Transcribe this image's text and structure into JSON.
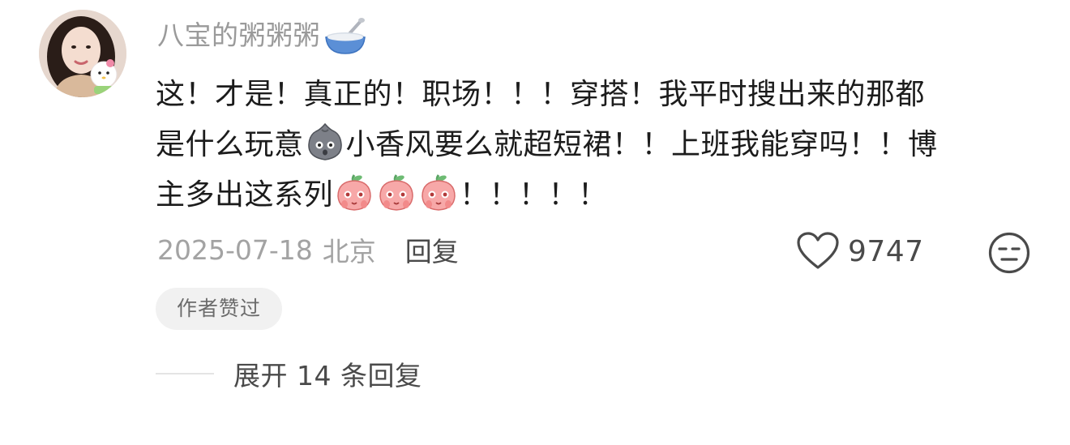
{
  "comment": {
    "avatar_icon": "user-avatar",
    "username": "八宝的粥粥粥",
    "username_emoji": "bowl-with-spoon-emoji",
    "text_lines": {
      "l1": "这！才是！真正的！职场！！！穿搭！我平时搜出来的那都",
      "l2a": "是什么玩意",
      "l2b": "小香风要么就超短裙！！上班我能穿吗！！博",
      "l3a": "主多出这系列",
      "l3b": "！！！！！"
    },
    "inline_emojis": {
      "stone": "grey-rock-face-emoji",
      "peach": "pink-peach-face-emoji"
    },
    "date": "2025-07-18",
    "location": "北京",
    "reply_label": "回复",
    "like_icon": "heart-outline-icon",
    "like_count": "9747",
    "dislike_icon": "neutral-face-icon",
    "author_liked_badge": "作者赞过",
    "expand_replies_label": "展开 14 条回复"
  },
  "colors": {
    "username": "#9a9a9a",
    "text": "#1c1c1c",
    "meta": "#a3a3a3",
    "action": "#4a4a4a",
    "badge_bg": "#f1f1f1"
  }
}
